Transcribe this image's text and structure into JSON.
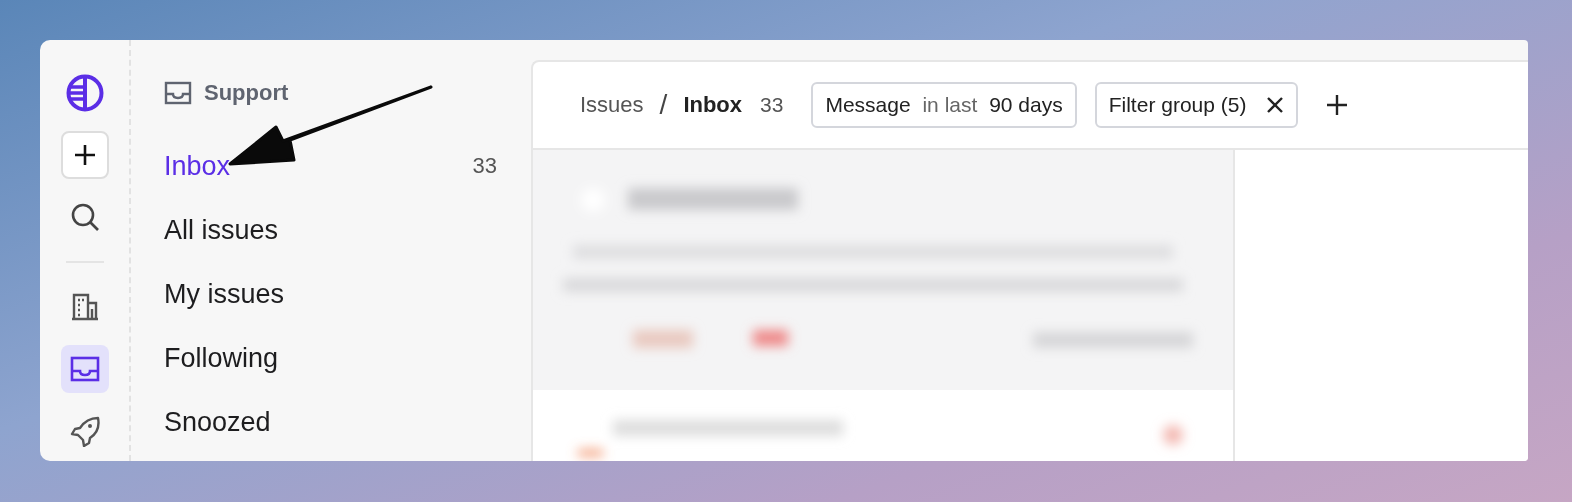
{
  "rail": [
    {
      "kind": "logo",
      "selected": false
    },
    {
      "kind": "plus",
      "selected": false
    },
    {
      "kind": "search",
      "selected": false
    },
    {
      "kind": "building",
      "selected": false
    },
    {
      "kind": "inbox",
      "selected": true
    },
    {
      "kind": "rocket",
      "selected": false
    }
  ],
  "sidebar": {
    "title": "Support",
    "items": [
      {
        "label": "Inbox",
        "count": "33",
        "selected": true
      },
      {
        "label": "All issues",
        "selected": false
      },
      {
        "label": "My issues",
        "selected": false
      },
      {
        "label": "Following",
        "selected": false
      },
      {
        "label": "Snoozed",
        "selected": false
      }
    ]
  },
  "header": {
    "breadcrumb": [
      "Issues",
      "Inbox"
    ],
    "separator": "/",
    "count": "33",
    "filters": [
      {
        "kind": "condition",
        "field": "Message",
        "operator": "in last",
        "value": "90 days"
      },
      {
        "kind": "group",
        "label": "Filter group (5)"
      }
    ]
  }
}
